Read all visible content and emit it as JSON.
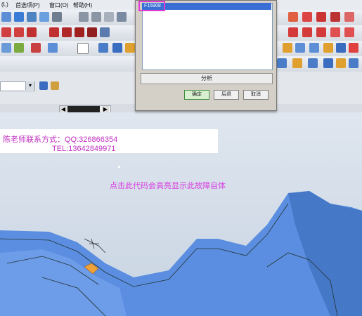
{
  "menubar": {
    "items": [
      "(L)",
      "首选项(P)",
      "窗口(O)",
      "帮助(H)"
    ]
  },
  "dialog": {
    "list_item": "F15908",
    "analyze_label": "分析",
    "ok_label": "确定",
    "back_label": "后退",
    "cancel_label": "取消"
  },
  "overlay": {
    "contact_line1": "陈老师联系方式：QQ:326866354",
    "contact_line2": "TEL:13642849971",
    "note": "点击此代码会高亮显示此故障自体"
  },
  "colors": {
    "highlight": "#e23bd4",
    "overlay_text": "#c030c0",
    "model": "#5b8ee0",
    "face_highlight": "#f0a23a"
  },
  "icons": {
    "toolbar": [
      "zoom-icon",
      "rotate-icon",
      "fit-icon",
      "view-icon",
      "render-icon",
      "analysis-icon"
    ]
  }
}
